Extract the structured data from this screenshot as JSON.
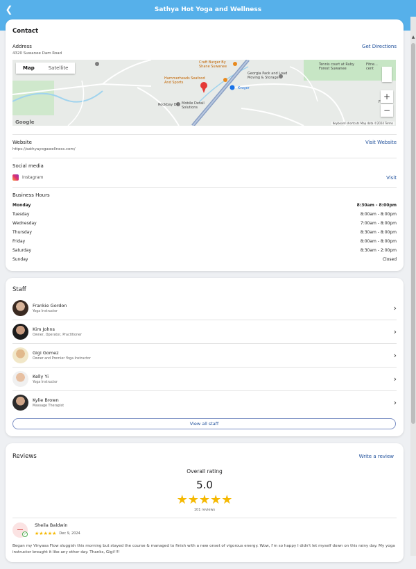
{
  "header": {
    "title": "Sathya Hot Yoga and Wellness",
    "back_icon": "back-chevron-icon"
  },
  "contact": {
    "title": "Contact",
    "address_label": "Address",
    "address_value": "4320 Suwanee Dam Road",
    "get_directions": "Get Directions",
    "map": {
      "tab_map": "Map",
      "tab_satellite": "Satellite",
      "google": "Google",
      "footer": "Keyboard shortcuts   Map data ©2024   Terms",
      "labels": {
        "craft_burger": "Craft Burger By Shane Suwanee",
        "hammerheads": "Hammerheads Seafood And Sports",
        "georgia_pack": "Georgia Pack and Load Moving & Storage",
        "tennis_court": "Tennis court at Ruby Forest Suwanee",
        "kroger": "Kroger",
        "mobile_detail": "Mobile Detail Solutions",
        "rockbay": "Rockbay Dr",
        "fitness": "Fitne... cent",
        "field": "Fiel"
      }
    },
    "website_label": "Website",
    "website_value": "https://sathyayogawellness.com/",
    "visit_website": "Visit Website",
    "social_label": "Social media",
    "instagram_label": "Instagram",
    "visit": "Visit",
    "hours_label": "Business Hours",
    "hours": [
      {
        "day": "Monday",
        "time": "8:30am - 8:00pm"
      },
      {
        "day": "Tuesday",
        "time": "8:00am - 8:00pm"
      },
      {
        "day": "Wednesday",
        "time": "7:00am - 8:00pm"
      },
      {
        "day": "Thursday",
        "time": "8:30am - 8:00pm"
      },
      {
        "day": "Friday",
        "time": "8:00am - 8:00pm"
      },
      {
        "day": "Saturday",
        "time": "8:30am - 2:00pm"
      },
      {
        "day": "Sunday",
        "time": "Closed"
      }
    ]
  },
  "staff": {
    "title": "Staff",
    "members": [
      {
        "name": "Frankie Gordon",
        "role": "Yoga Instructor"
      },
      {
        "name": "Kim Johns",
        "role": "Owner, Operator, Practitioner"
      },
      {
        "name": "Gigi Gomez",
        "role": "Owner and Premier Yoga Instructor"
      },
      {
        "name": "Kelly Yi",
        "role": "Yoga Instructor"
      },
      {
        "name": "Kylie Brown",
        "role": "Massage Therapist"
      }
    ],
    "view_all": "View all staff"
  },
  "reviews": {
    "title": "Reviews",
    "write_review": "Write a review",
    "overall_label": "Overall rating",
    "overall_value": "5.0",
    "overall_stars": 5,
    "count": "101 reviews",
    "items": [
      {
        "name": "Sheila Baldwin",
        "stars": 5,
        "date": "Dec 9, 2024",
        "text": "Began my Vinyasa Flow sluggish this morning but stayed the course & managed to finish with a new onset of vigorous energy. Wow, I'm so happy I didn't let myself down on this rainy day. My yoga instructor brought it like any other day. Thanks, Gigi!!!!"
      }
    ]
  },
  "colors": {
    "header": "#56b0ea",
    "link": "#1d4e9a",
    "star": "#f5b800",
    "map_pin": "#e53935"
  }
}
